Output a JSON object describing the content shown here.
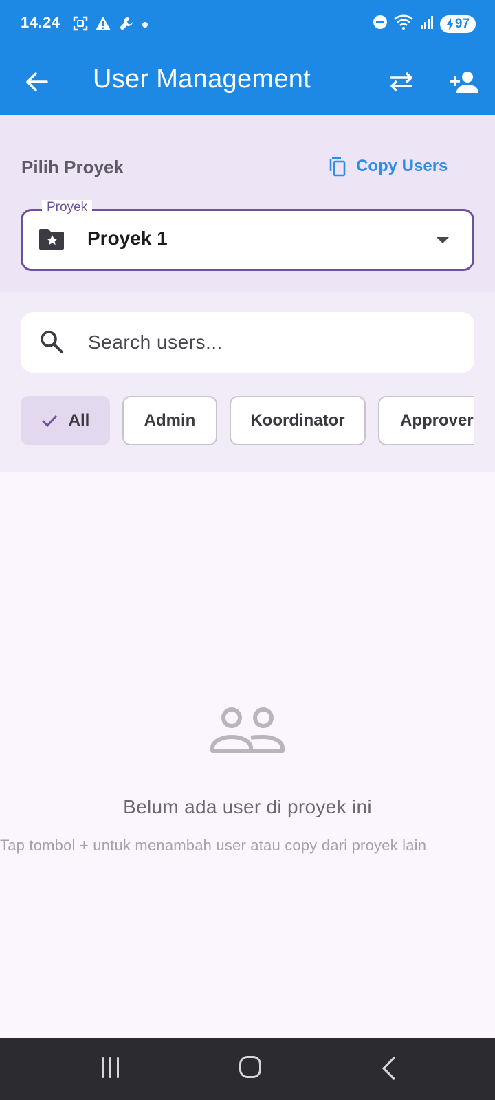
{
  "status_bar": {
    "time": "14.24",
    "battery": "97"
  },
  "app_bar": {
    "title": "User Management"
  },
  "project_section": {
    "title": "Pilih Proyek",
    "copy_label": "Copy Users",
    "field_label": "Proyek",
    "selected_project": "Proyek 1"
  },
  "search": {
    "placeholder": "Search users..."
  },
  "filters": [
    {
      "label": "All",
      "selected": true
    },
    {
      "label": "Admin",
      "selected": false
    },
    {
      "label": "Koordinator",
      "selected": false
    },
    {
      "label": "Approver",
      "selected": false
    }
  ],
  "empty_state": {
    "title": "Belum ada user di proyek ini",
    "subtitle": "Tap tombol + untuk menambah user atau copy dari proyek lain"
  },
  "colors": {
    "app_bar": "#1e88e5",
    "accent": "#6a52a3",
    "link": "#2f8ee3"
  }
}
